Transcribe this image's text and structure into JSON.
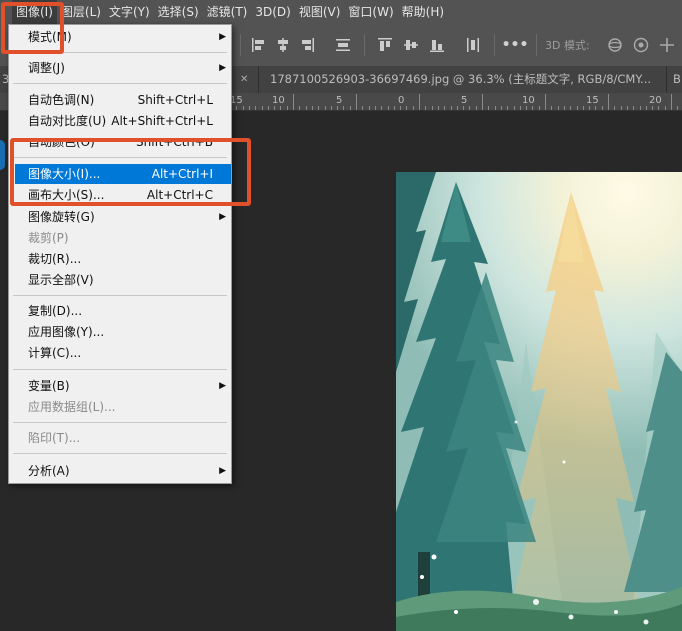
{
  "menubar": {
    "items": [
      "图像(I)",
      "图层(L)",
      "文字(Y)",
      "选择(S)",
      "滤镜(T)",
      "3D(D)",
      "视图(V)",
      "窗口(W)",
      "帮助(H)"
    ]
  },
  "options_bar": {
    "threed_label": "3D 模式:",
    "more_icon": "ellipsis-icon"
  },
  "tabs": {
    "left_fragment": "3",
    "active_tab": "1787100526903-36697469.jpg @ 36.3% (主标题文字, RGB/8/CMY...",
    "right_fragment": "B"
  },
  "ruler": {
    "labels": [
      "15",
      "10",
      "5",
      "0",
      "5",
      "10",
      "15",
      "20"
    ]
  },
  "menu": {
    "items": [
      {
        "label": "模式(M)",
        "shortcut": "",
        "submenu": true,
        "state": "normal"
      },
      {
        "label": "调整(J)",
        "shortcut": "",
        "submenu": true,
        "state": "normal"
      },
      {
        "label": "自动色调(N)",
        "shortcut": "Shift+Ctrl+L",
        "submenu": false,
        "state": "normal"
      },
      {
        "label": "自动对比度(U)",
        "shortcut": "Alt+Shift+Ctrl+L",
        "submenu": false,
        "state": "normal"
      },
      {
        "label": "自动颜色(O)",
        "shortcut": "Shift+Ctrl+B",
        "submenu": false,
        "state": "normal"
      },
      {
        "label": "图像大小(I)...",
        "shortcut": "Alt+Ctrl+I",
        "submenu": false,
        "state": "highlighted"
      },
      {
        "label": "画布大小(S)...",
        "shortcut": "Alt+Ctrl+C",
        "submenu": false,
        "state": "normal"
      },
      {
        "label": "图像旋转(G)",
        "shortcut": "",
        "submenu": true,
        "state": "normal"
      },
      {
        "label": "裁剪(P)",
        "shortcut": "",
        "submenu": false,
        "state": "disabled"
      },
      {
        "label": "裁切(R)...",
        "shortcut": "",
        "submenu": false,
        "state": "normal"
      },
      {
        "label": "显示全部(V)",
        "shortcut": "",
        "submenu": false,
        "state": "normal"
      },
      {
        "label": "复制(D)...",
        "shortcut": "",
        "submenu": false,
        "state": "normal"
      },
      {
        "label": "应用图像(Y)...",
        "shortcut": "",
        "submenu": false,
        "state": "normal"
      },
      {
        "label": "计算(C)...",
        "shortcut": "",
        "submenu": false,
        "state": "normal"
      },
      {
        "label": "变量(B)",
        "shortcut": "",
        "submenu": true,
        "state": "normal"
      },
      {
        "label": "应用数据组(L)...",
        "shortcut": "",
        "submenu": false,
        "state": "disabled"
      },
      {
        "label": "陷印(T)...",
        "shortcut": "",
        "submenu": false,
        "state": "disabled"
      },
      {
        "label": "分析(A)",
        "shortcut": "",
        "submenu": true,
        "state": "normal"
      }
    ]
  },
  "colors": {
    "highlight": "#0078d7",
    "annotation_red": "#e0502a",
    "menubar_bg": "#535353",
    "canvas_bg": "#282828"
  }
}
